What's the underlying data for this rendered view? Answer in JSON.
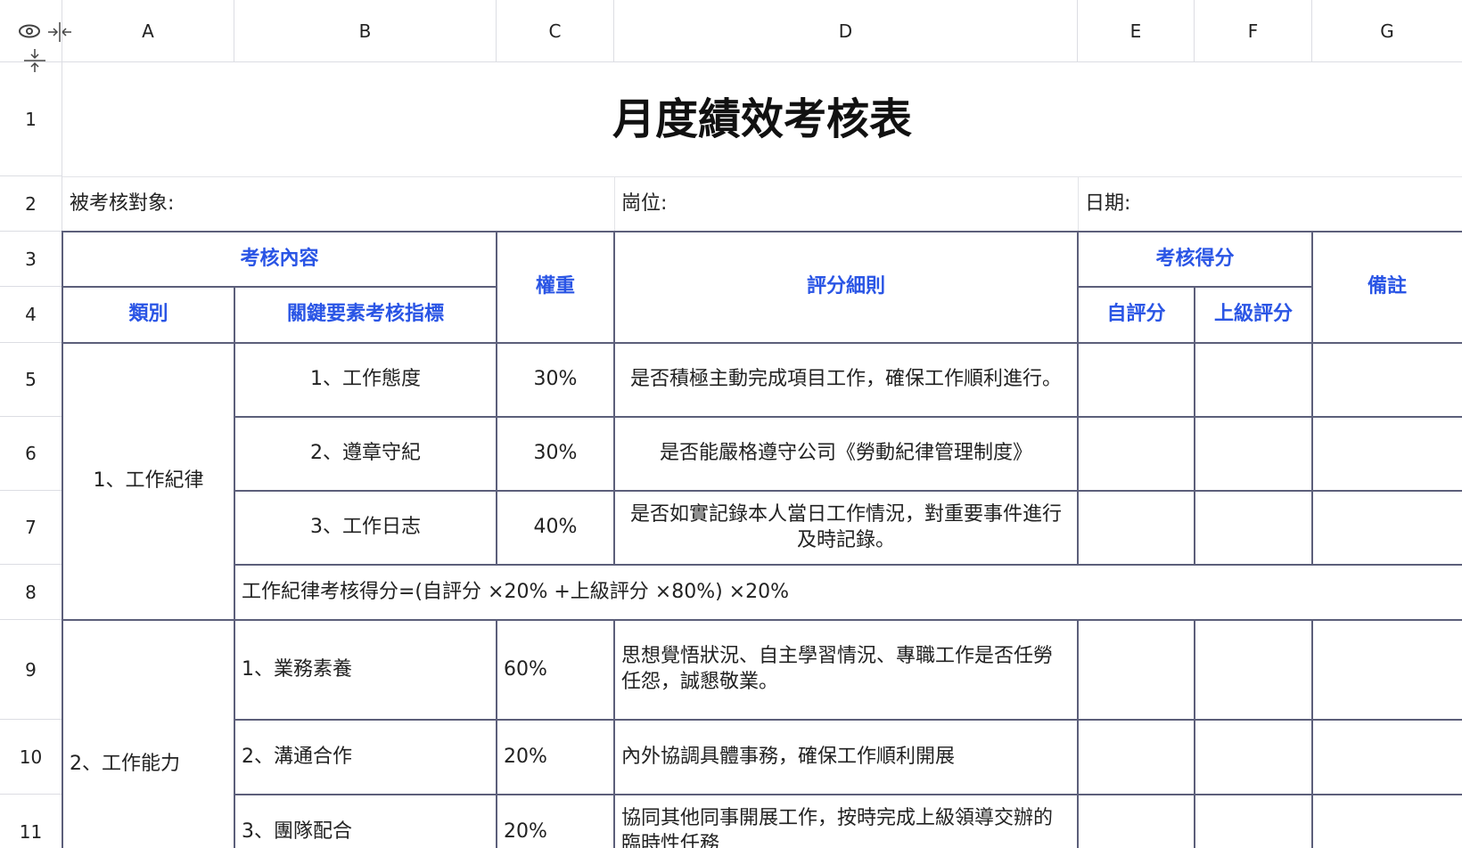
{
  "columns": [
    "A",
    "B",
    "C",
    "D",
    "E",
    "F",
    "G"
  ],
  "rows": [
    "1",
    "2",
    "3",
    "4",
    "5",
    "6",
    "7",
    "8",
    "9",
    "10",
    "11"
  ],
  "corner_icons": [
    "eye-icon",
    "collapse-horizontal-icon",
    "collapse-vertical-icon"
  ],
  "sheet": {
    "title": "月度績效考核表",
    "row2": {
      "subject_label": "被考核對象:",
      "position_label": "崗位:",
      "date_label": "日期:"
    },
    "header": {
      "content": "考核內容",
      "category": "類別",
      "indicator": "關鍵要素考核指標",
      "weight": "權重",
      "rules": "評分細則",
      "score": "考核得分",
      "self_score": "自評分",
      "superior_score": "上級評分",
      "remarks": "備註"
    },
    "groups": [
      {
        "category": "1、工作紀律",
        "items": [
          {
            "indicator": "1、工作態度",
            "weight": "30%",
            "rule": "是否積極主動完成項目工作，確保工作順利進行。"
          },
          {
            "indicator": "2、遵章守紀",
            "weight": "30%",
            "rule": "是否能嚴格遵守公司《勞動紀律管理制度》"
          },
          {
            "indicator": "3、工作日志",
            "weight": "40%",
            "rule": "是否如實記錄本人當日工作情況，對重要事件進行及時記錄。"
          }
        ],
        "formula": "工作紀律考核得分=(自評分 ×20% +上級評分 ×80%) ×20%"
      },
      {
        "category": "2、工作能力",
        "items": [
          {
            "indicator": "1、業務素養",
            "weight": "60%",
            "rule": "思想覺悟狀況、自主學習情況、專職工作是否任勞任怨，誠懇敬業。"
          },
          {
            "indicator": "2、溝通合作",
            "weight": "20%",
            "rule": "內外協調具體事務，確保工作順利開展"
          },
          {
            "indicator": "3、團隊配合",
            "weight": "20%",
            "rule": "協同其他同事開展工作，按時完成上級領導交辦的臨時性任務"
          }
        ]
      }
    ]
  }
}
